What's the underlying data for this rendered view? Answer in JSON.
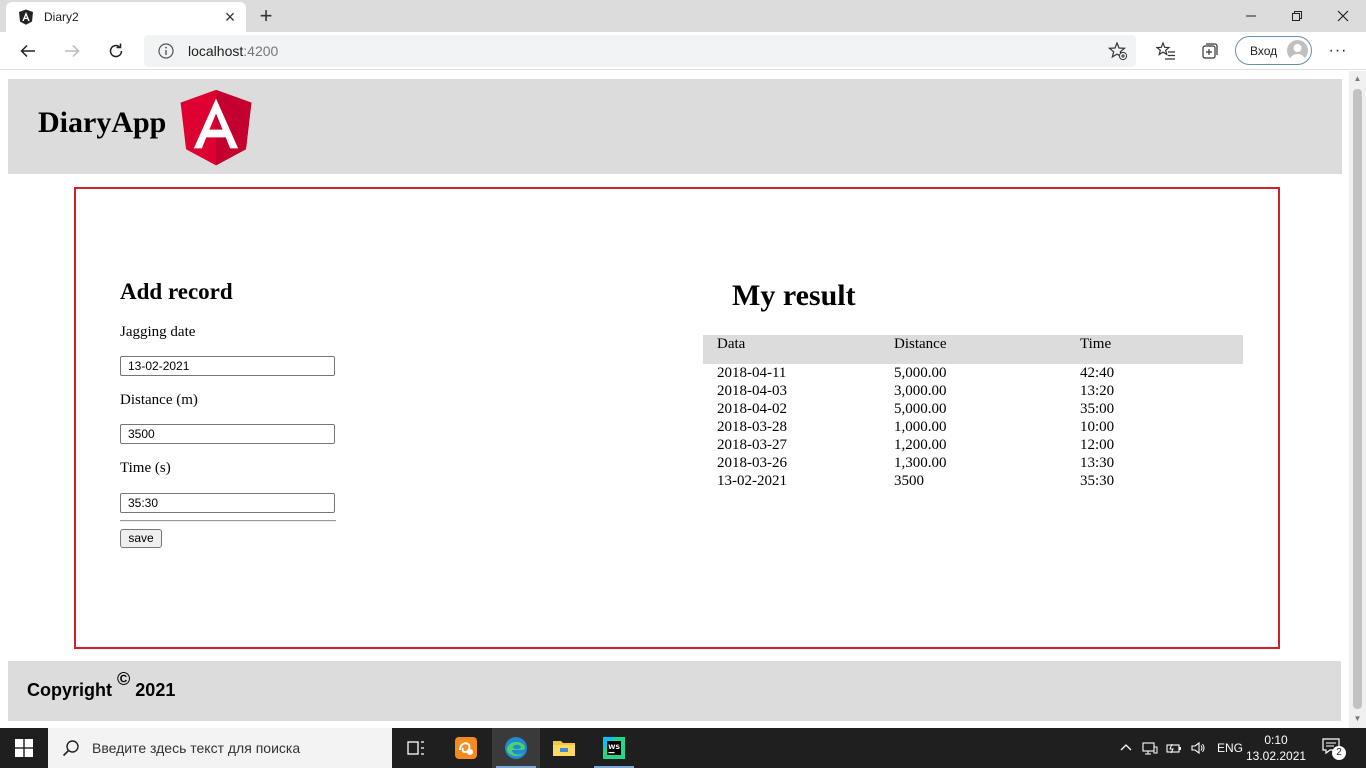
{
  "browser": {
    "tab_title": "Diary2",
    "url_host": "localhost",
    "url_port": ":4200",
    "login_label": "Вход"
  },
  "app": {
    "title": "DiaryApp"
  },
  "form": {
    "title": "Add record",
    "date_label": "Jagging date",
    "date_value": "13-02-2021",
    "distance_label": "Distance (m)",
    "distance_value": "3500",
    "time_label": "Time (s)",
    "time_value": "35:30",
    "save_label": "save"
  },
  "results": {
    "title": "My result",
    "columns": [
      "Data",
      "Distance",
      "Time"
    ],
    "rows": [
      [
        "2018-04-11",
        "5,000.00",
        "42:40"
      ],
      [
        "2018-04-03",
        "3,000.00",
        "13:20"
      ],
      [
        "2018-04-02",
        "5,000.00",
        "35:00"
      ],
      [
        "2018-03-28",
        "1,000.00",
        "10:00"
      ],
      [
        "2018-03-27",
        "1,200.00",
        "12:00"
      ],
      [
        "2018-03-26",
        "1,300.00",
        "13:30"
      ],
      [
        "13-02-2021",
        "3500",
        "35:30"
      ]
    ]
  },
  "footer": {
    "prefix": "Copyright",
    "symbol": "©",
    "year": "2021"
  },
  "taskbar": {
    "search_placeholder": "Введите здесь текст для поиска",
    "language": "ENG",
    "time": "0:10",
    "date": "13.02.2021",
    "notification_count": "2"
  },
  "colors": {
    "accent_border": "#d02028",
    "header_bg": "#dcdcdc",
    "angular_red": "#dd0031"
  }
}
